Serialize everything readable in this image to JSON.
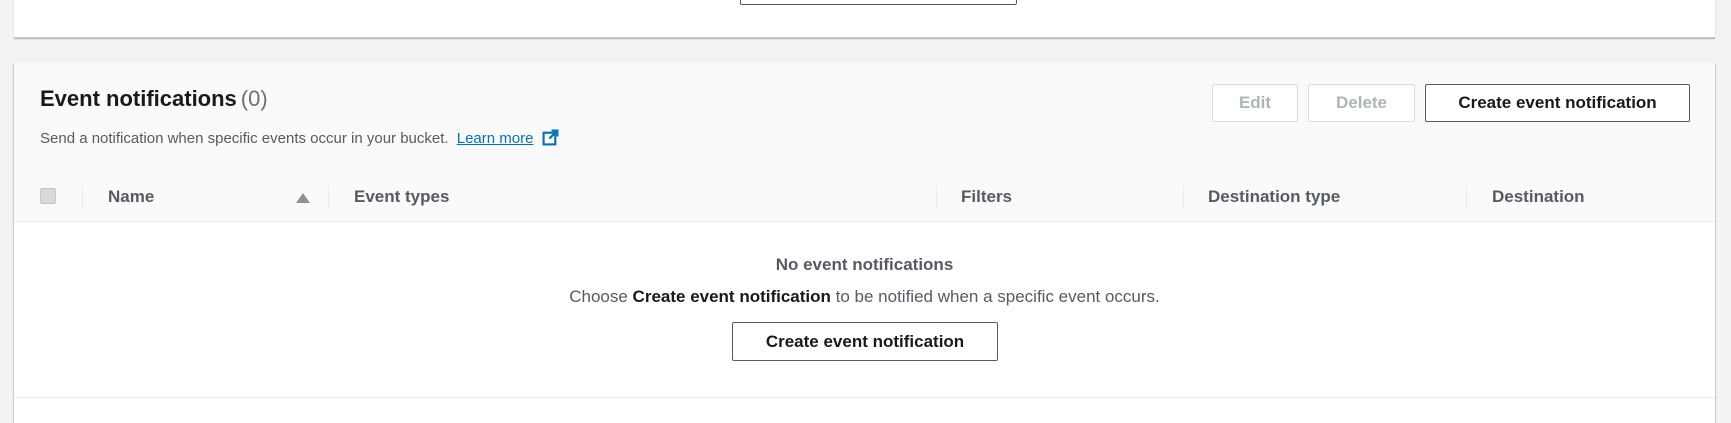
{
  "header": {
    "title": "Event notifications",
    "count": "(0)",
    "description": "Send a notification when specific events occur in your bucket.",
    "learn_more": "Learn more",
    "buttons": {
      "edit": "Edit",
      "delete": "Delete",
      "create": "Create event notification"
    }
  },
  "table": {
    "columns": [
      "Name",
      "Event types",
      "Filters",
      "Destination type",
      "Destination"
    ]
  },
  "empty_state": {
    "title": "No event notifications",
    "desc_prefix": "Choose ",
    "desc_bold": "Create event notification",
    "desc_suffix": " to be notified when a specific event occurs.",
    "button": "Create event notification"
  },
  "colors": {
    "link": "#0073bb",
    "text": "#16191f",
    "muted": "#545b64",
    "disabled": "#aab7b8"
  }
}
